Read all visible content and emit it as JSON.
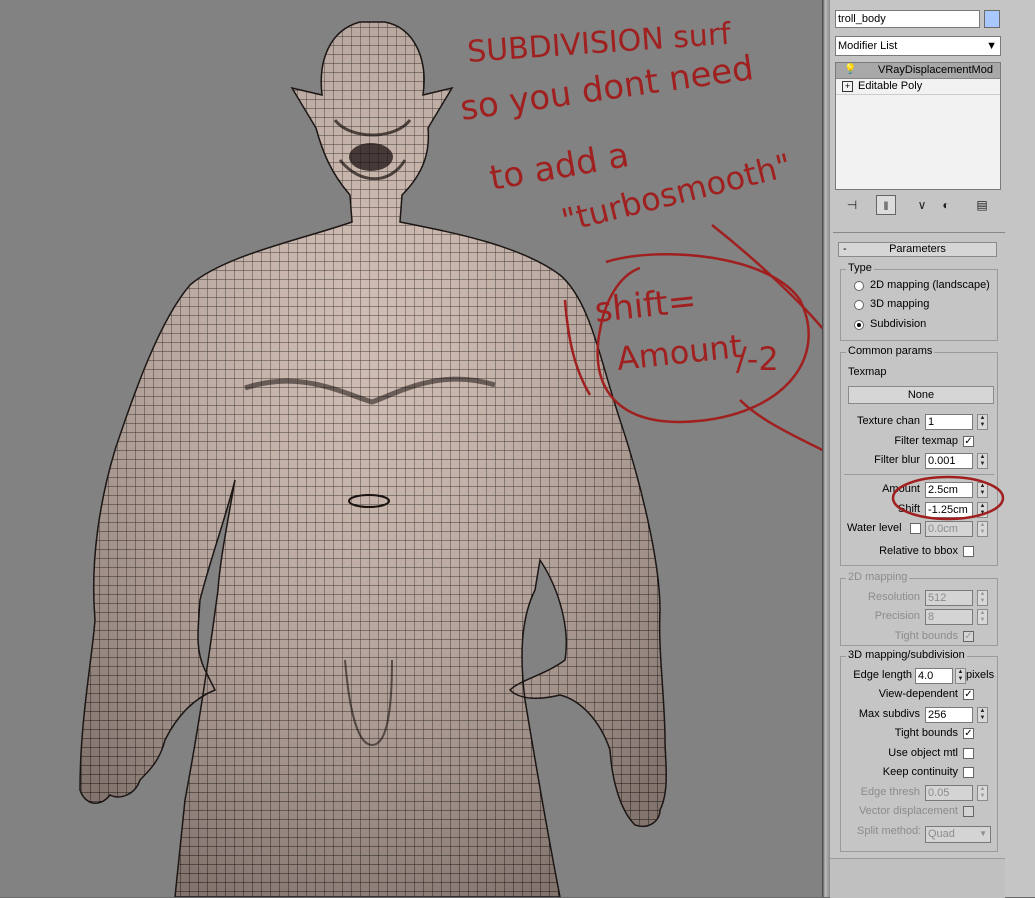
{
  "viewport": {
    "annotations": {
      "line1": "SUBDIVISION surf",
      "line2": "so you dont need",
      "line3": "to add a",
      "line4": "\"turbosmooth\"",
      "shift_note_1": "shift=",
      "shift_note_2": "Amount",
      "shift_note_3": "/-2"
    }
  },
  "panel": {
    "object_name": "troll_body",
    "object_color": "#a8c8ff",
    "modifier_list_label": "Modifier List",
    "modifier_stack": [
      "VRayDisplacementMod",
      "Editable Poly"
    ],
    "toolbar_icons": [
      "pin-stack-icon",
      "show-end-result-icon",
      "make-unique-icon",
      "remove-modifier-icon",
      "configure-modifier-sets-icon"
    ],
    "rollout_title": "Parameters",
    "type": {
      "title": "Type",
      "options": [
        "2D mapping (landscape)",
        "3D mapping",
        "Subdivision"
      ],
      "selected": "Subdivision"
    },
    "common": {
      "title": "Common params",
      "texmap_label": "Texmap",
      "texmap_button": "None",
      "texture_chan_label": "Texture chan",
      "texture_chan_value": "1",
      "filter_texmap_label": "Filter texmap",
      "filter_texmap_checked": "✓",
      "filter_blur_label": "Filter blur",
      "filter_blur_value": "0.001",
      "amount_label": "Amount",
      "amount_value": "2.5cm",
      "shift_label": "Shift",
      "shift_value": "-1.25cm",
      "water_level_label": "Water level",
      "water_level_value": "0.0cm",
      "relative_label": "Relative to bbox"
    },
    "mapping2d": {
      "title": "2D mapping",
      "resolution_label": "Resolution",
      "resolution_value": "512",
      "precision_label": "Precision",
      "precision_value": "8",
      "tight_bounds_label": "Tight bounds",
      "tight_bounds_checked": "✓"
    },
    "mapping3d": {
      "title": "3D mapping/subdivision",
      "edge_length_label": "Edge length",
      "edge_length_value": "4.0",
      "pixels_label": "pixels",
      "view_dependent_label": "View-dependent",
      "view_dependent_checked": "✓",
      "max_subdivs_label": "Max subdivs",
      "max_subdivs_value": "256",
      "tight_bounds_label": "Tight bounds",
      "tight_bounds_checked": "✓",
      "use_object_mtl_label": "Use object mtl",
      "keep_continuity_label": "Keep continuity",
      "edge_thresh_label": "Edge thresh",
      "edge_thresh_value": "0.05",
      "vector_displacement_label": "Vector displacement",
      "split_method_label": "Split method:",
      "split_method_value": "Quad"
    }
  }
}
